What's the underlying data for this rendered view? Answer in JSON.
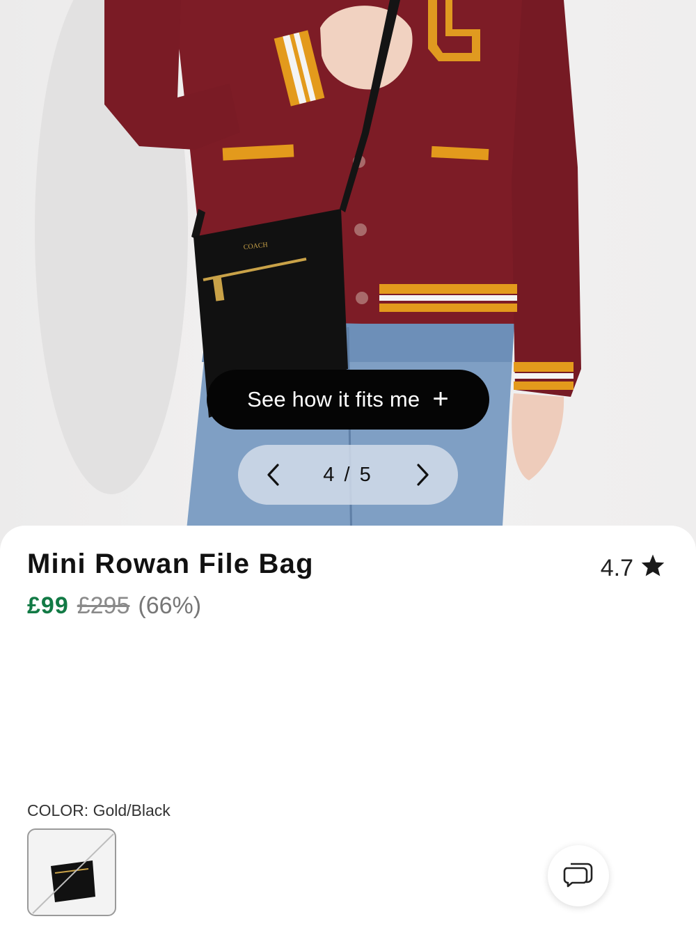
{
  "gallery": {
    "fit_button_label": "See how it fits me",
    "fit_button_icon": "plus-icon",
    "current": 4,
    "total": 5,
    "counter_text": "4 / 5",
    "prev_icon": "chevron-left-icon",
    "next_icon": "chevron-right-icon"
  },
  "product": {
    "title": "Mini Rowan File Bag",
    "rating": "4.7",
    "rating_icon": "star-icon",
    "price": "£99",
    "original_price": "£295",
    "discount": "(66%)",
    "color_label": "COLOR: Gold/Black",
    "swatch_icon": "bag-thumbnail"
  },
  "colors": {
    "price_accent": "#127a45",
    "pill_background": "#050505",
    "jacket": "#7d1c26"
  },
  "support": {
    "chat_icon": "chat-bubble-icon"
  }
}
